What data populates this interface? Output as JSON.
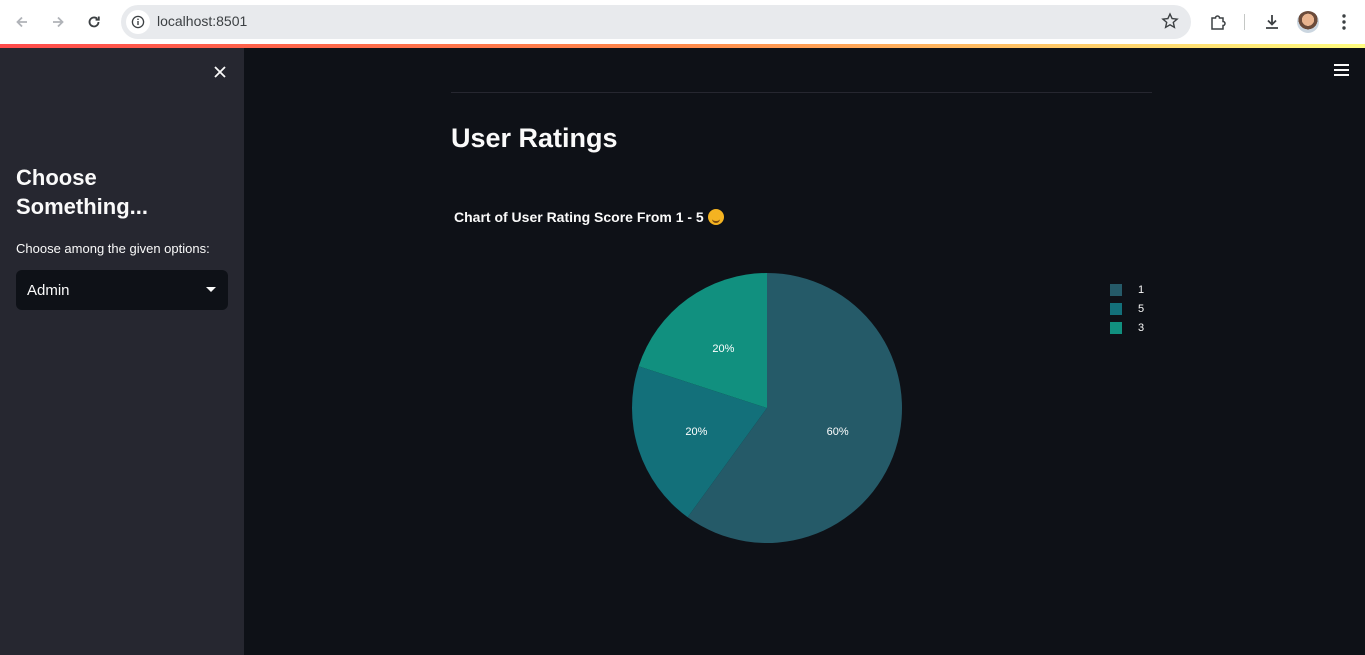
{
  "browser": {
    "url": "localhost:8501"
  },
  "sidebar": {
    "title": "Choose Something...",
    "select_label": "Choose among the given options:",
    "select_value": "Admin"
  },
  "main": {
    "title": "User Ratings",
    "chart_title": "Chart of User Rating Score From 1 - 5"
  },
  "colors": {
    "app_bg": "#0e1117",
    "sidebar_bg": "#262730",
    "slice_1": "#255a68",
    "slice_5": "#13707a",
    "slice_3": "#11907f"
  },
  "chart_data": {
    "type": "pie",
    "labels": [
      "1",
      "5",
      "3"
    ],
    "values": [
      60,
      20,
      20
    ],
    "value_labels": [
      "60%",
      "20%",
      "20%"
    ],
    "colors": [
      "#255a68",
      "#13707a",
      "#11907f"
    ],
    "legend": "top-right"
  }
}
